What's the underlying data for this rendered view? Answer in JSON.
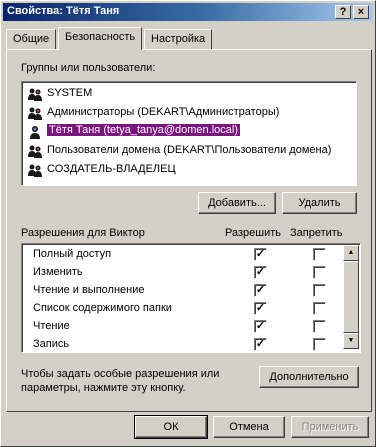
{
  "window": {
    "title": "Свойства: Тётя Таня",
    "help_label": "?",
    "close_label": "×"
  },
  "tabs": [
    {
      "label": "Общие",
      "active": false
    },
    {
      "label": "Безопасность",
      "active": true
    },
    {
      "label": "Настройка",
      "active": false
    }
  ],
  "users_section": {
    "label": "Группы или пользователи:",
    "items": [
      {
        "name": "SYSTEM",
        "icon": "users-group-icon",
        "selected": false
      },
      {
        "name": "Администраторы (DEKART\\Администраторы)",
        "icon": "users-group-icon",
        "selected": false
      },
      {
        "name": "Тётя Таня (tetya_tanya@domen.local)",
        "icon": "user-icon",
        "selected": true
      },
      {
        "name": "Пользователи домена (DEKART\\Пользователи домена)",
        "icon": "users-group-icon",
        "selected": false
      },
      {
        "name": "СОЗДАТЕЛЬ-ВЛАДЕЛЕЦ",
        "icon": "users-group-icon",
        "selected": false
      }
    ],
    "add_label": "Добавить...",
    "remove_label": "Удалить"
  },
  "permissions": {
    "header_label": "Разрешения для Виктор",
    "allow_header": "Разрешить",
    "deny_header": "Запретить",
    "rows": [
      {
        "name": "Полный доступ",
        "allow": true,
        "deny": false
      },
      {
        "name": "Изменить",
        "allow": true,
        "deny": false
      },
      {
        "name": "Чтение и выполнение",
        "allow": true,
        "deny": false
      },
      {
        "name": "Список содержимого папки",
        "allow": true,
        "deny": false
      },
      {
        "name": "Чтение",
        "allow": true,
        "deny": false
      },
      {
        "name": "Запись",
        "allow": true,
        "deny": false
      }
    ]
  },
  "special": {
    "text_line1": "Чтобы задать особые разрешения или",
    "text_line2": "параметры, нажмите эту кнопку.",
    "advanced_label": "Дополнительно"
  },
  "footer": {
    "ok_label": "ОК",
    "cancel_label": "Отмена",
    "apply_label": "Применить"
  },
  "colors": {
    "selection": "#7b1680",
    "title_start": "#0a246a",
    "face": "#d4d0c8"
  }
}
